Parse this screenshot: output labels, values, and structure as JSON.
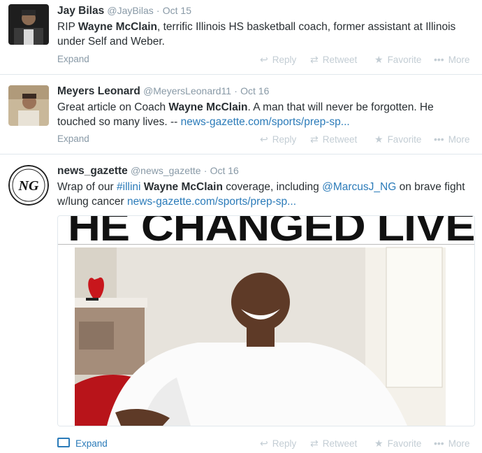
{
  "tweets": [
    {
      "fullname": "Jay Bilas",
      "username": "@JayBilas",
      "sep": "·",
      "time": "Oct 15",
      "text_parts": [
        "RIP ",
        "Wayne McClain",
        ", terrific Illinois HS basketball coach, former assistant at Illinois under Self and Weber."
      ],
      "expand": "Expand"
    },
    {
      "fullname": "Meyers Leonard",
      "username": "@MeyersLeonard11",
      "sep": "·",
      "time": "Oct 16",
      "text_parts": [
        "Great article on Coach ",
        "Wayne McClain",
        ". A man that will never be forgotten. He touched so many lives. -- "
      ],
      "link": "news-gazette.com/sports/prep-sp...",
      "expand": "Expand"
    },
    {
      "fullname": "news_gazette",
      "username": "@news_gazette",
      "sep": "·",
      "time": "Oct 16",
      "text_parts": [
        "Wrap of our ",
        "#illini",
        " ",
        "Wayne McClain",
        " coverage, including ",
        "@MarcusJ_NG",
        " on brave fight w/lung cancer "
      ],
      "link": "news-gazette.com/sports/prep-sp...",
      "avatar_text": "NG",
      "expand": "Expand",
      "media_headline": "HE CHANGED LIVES"
    }
  ],
  "actions": {
    "reply": "Reply",
    "retweet": "Retweet",
    "favorite": "Favorite",
    "more": "More"
  },
  "colors": {
    "link": "#2b7bb9",
    "meta": "#8899a6",
    "action": "#c3cdd4"
  }
}
